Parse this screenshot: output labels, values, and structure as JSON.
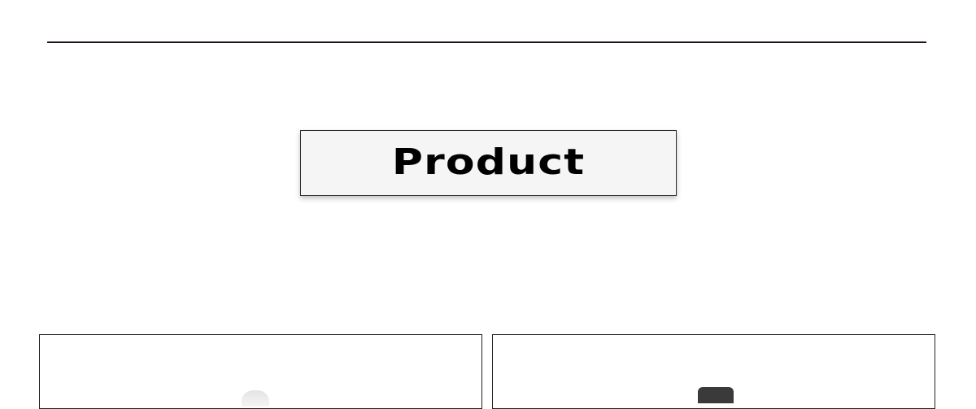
{
  "section": {
    "title": "Product"
  },
  "products": [
    {
      "image_icon": "product-photo-icon"
    },
    {
      "image_icon": "product-photo-icon"
    }
  ]
}
